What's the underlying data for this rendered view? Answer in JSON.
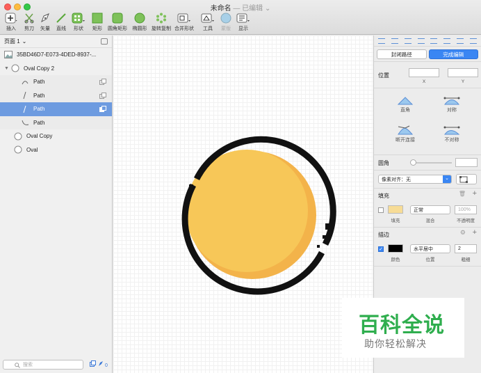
{
  "window": {
    "title": "未命名",
    "subtitle": "— 已编辑",
    "chevron": "chevron-down-icon"
  },
  "toolbar": {
    "insert": "插入",
    "scissors": "剪刀",
    "vector": "矢量",
    "line": "直线",
    "shape": "形状",
    "rectangle": "矩形",
    "rounded_rect": "圆角矩形",
    "oval": "椭圆形",
    "rotate_copy": "旋转复制",
    "combine": "合并形状",
    "tools": "工具",
    "mask": "蒙版",
    "view": "显示"
  },
  "sidebar": {
    "page": "页面 1",
    "layers": [
      {
        "label": "35BD46D7-E073-4DED-8937-...",
        "icon": "image-icon"
      },
      {
        "label": "Oval Copy 2",
        "icon": "oval-icon"
      },
      {
        "label": "Path",
        "icon": "arc-path-icon"
      },
      {
        "label": "Path",
        "icon": "line-path-icon"
      },
      {
        "label": "Path",
        "icon": "line-path-icon"
      },
      {
        "label": "Path",
        "icon": "curve-path-icon"
      },
      {
        "label": "Oval Copy",
        "icon": "oval-icon"
      },
      {
        "label": "Oval",
        "icon": "oval-icon"
      }
    ],
    "search_placeholder": "搜索",
    "count": "0"
  },
  "inspector": {
    "close_path": "封闭路径",
    "done_editing": "完成编辑",
    "position": "位置",
    "x_label": "X",
    "y_label": "Y",
    "point_types": [
      "直角",
      "对称",
      "断开连接",
      "不对称"
    ],
    "corner_radius": "圆角",
    "pixel_align": "像素对齐：无",
    "fill": {
      "title": "填充",
      "blend": "正常",
      "opacity": "100%",
      "fill_cap": "填充",
      "blend_cap": "混合",
      "opacity_cap": "不透明度",
      "color": "#f7dc96"
    },
    "border": {
      "title": "描边",
      "position_value": "水平居中",
      "width": "2",
      "color_cap": "颜色",
      "position_cap": "位置",
      "width_cap": "粗细",
      "color": "#000000"
    }
  },
  "canvas": {
    "fill_color": "#f7c758",
    "shadow_color": "#f3b34a",
    "stroke_color": "#111111"
  },
  "watermark": {
    "big": "百科全说",
    "small": "助你轻松解决"
  }
}
